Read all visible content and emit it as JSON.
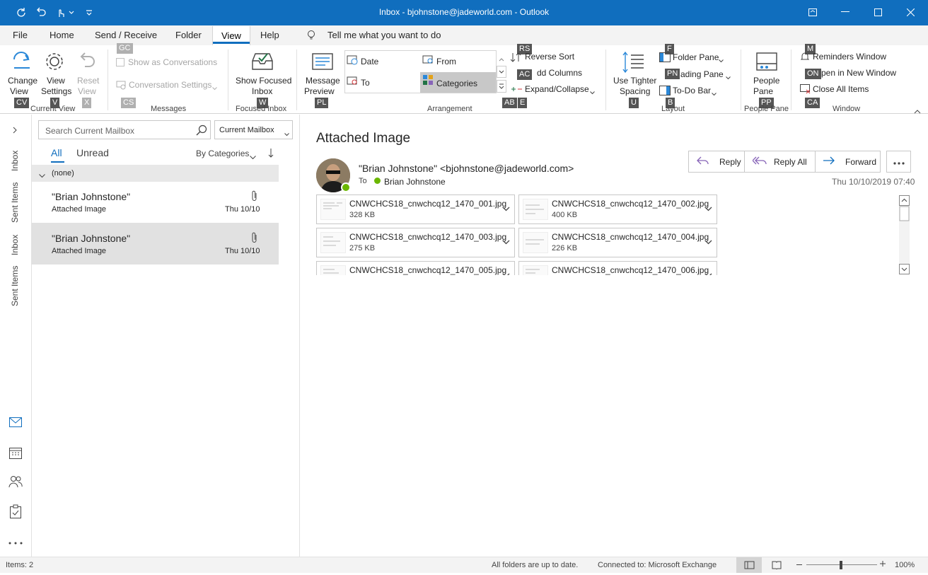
{
  "window": {
    "title": "Inbox - bjohnstone@jadeworld.com  -  Outlook"
  },
  "tabs": [
    "File",
    "Home",
    "Send / Receive",
    "Folder",
    "View",
    "Help"
  ],
  "tell_me": "Tell me what you want to do",
  "ribbon": {
    "current_view": {
      "change_view_1": "Change",
      "change_view_2": "View",
      "view_settings_1": "View",
      "view_settings_2": "Settings",
      "reset_view_1": "Reset",
      "reset_view_2": "View",
      "group": "Current View"
    },
    "messages": {
      "show_conversations": "Show as Conversations",
      "conversation_settings": "Conversation Settings",
      "group": "Messages"
    },
    "focused": {
      "btn_1": "Show Focused",
      "btn_2": "Inbox",
      "group": "Focused Inbox"
    },
    "arrangement": {
      "message_preview_1": "Message",
      "message_preview_2": "Preview",
      "date": "Date",
      "from": "From",
      "to": "To",
      "categories": "Categories",
      "reverse_sort": "Reverse Sort",
      "add_columns": "dd Columns",
      "expand_collapse": "Expand/Collapse",
      "group": "Arrangement"
    },
    "layout": {
      "tighter_1": "Use Tighter",
      "tighter_2": "Spacing",
      "folder_pane": "Folder Pane",
      "reading_pane": "ading Pane",
      "todo_bar": "To-Do Bar",
      "group": "Layout"
    },
    "people": {
      "btn_1": "People",
      "btn_2": "Pane",
      "group": "People Pane"
    },
    "window": {
      "reminders": "Reminders Window",
      "open_new": "pen in New Window",
      "close_all": "Close All Items",
      "group": "Window"
    },
    "keytips": {
      "cv": "CV",
      "v": "V",
      "x": "X",
      "gc": "GC",
      "cs": "CS",
      "w": "W",
      "pl": "PL",
      "rs": "RS",
      "ac": "AC",
      "ab": "AB",
      "e": "E",
      "u": "U",
      "f": "F",
      "pn": "PN",
      "b": "B",
      "pp": "PP",
      "m": "M",
      "on": "ON",
      "ca": "CA"
    }
  },
  "nav": {
    "folders": [
      "Inbox",
      "Sent Items",
      "Inbox",
      "Sent Items"
    ]
  },
  "list": {
    "search_placeholder": "Search Current Mailbox",
    "scope": "Current Mailbox",
    "filter_all": "All",
    "filter_unread": "Unread",
    "sort": "By Categories",
    "group_header": "(none)",
    "messages": [
      {
        "from": "\"Brian Johnstone\"",
        "subject": "Attached Image",
        "date": "Thu 10/10"
      },
      {
        "from": "\"Brian Johnstone\"",
        "subject": "Attached Image",
        "date": "Thu 10/10"
      }
    ]
  },
  "reading": {
    "subject": "Attached Image",
    "sender": "\"Brian Johnstone\" <bjohnstone@jadeworld.com>",
    "to_label": "To",
    "recipient": "Brian Johnstone",
    "date": "Thu 10/10/2019 07:40",
    "reply": "Reply",
    "reply_all": "Reply All",
    "forward": "Forward",
    "more": "...",
    "attachments": [
      {
        "name": "CNWCHCS18_cnwchcq12_1470_001.jpg",
        "size": "328 KB"
      },
      {
        "name": "CNWCHCS18_cnwchcq12_1470_002.jpg",
        "size": "400 KB"
      },
      {
        "name": "CNWCHCS18_cnwchcq12_1470_003.jpg",
        "size": "275 KB"
      },
      {
        "name": "CNWCHCS18_cnwchcq12_1470_004.jpg",
        "size": "226 KB"
      },
      {
        "name": "CNWCHCS18_cnwchcq12_1470_005.jpg",
        "size": ""
      },
      {
        "name": "CNWCHCS18_cnwchcq12_1470_006.jpg",
        "size": ""
      }
    ]
  },
  "status": {
    "items": "Items: 2",
    "sync": "All folders are up to date.",
    "connection": "Connected to: Microsoft Exchange",
    "zoom": "100%"
  },
  "colors": {
    "accent": "#106ebe",
    "selected_row": "#e1e1e1"
  }
}
